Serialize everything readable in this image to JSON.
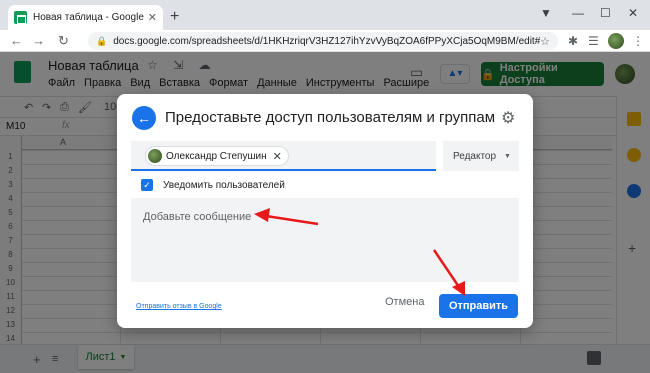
{
  "browser": {
    "tab_title": "Новая таблица - Google Таблицы",
    "tab_close": "✕",
    "new_tab": "+",
    "url": "docs.google.com/spreadsheets/d/1HKHzriqrV3HZ127ihYzvVyBqZOA6fPPyXCja5OqM9BM/edit#gid=0",
    "minimize": "—",
    "maximize": "☐",
    "close": "✕"
  },
  "app": {
    "doc_title": "Новая таблица",
    "menu": [
      "Файл",
      "Правка",
      "Вид",
      "Вставка",
      "Формат",
      "Данные",
      "Инструменты",
      "Расшире"
    ],
    "share_label": "Настройки Доступа",
    "zoom": "100",
    "namebox": "M10",
    "fx": "fx",
    "col_a": "A",
    "row_numbers": [
      "1",
      "2",
      "3",
      "4",
      "5",
      "6",
      "7",
      "8",
      "9",
      "10",
      "11",
      "12",
      "13",
      "14"
    ],
    "sheet_tab": "Лист1"
  },
  "dialog": {
    "title": "Предоставьте доступ пользователям и группам",
    "chip_name": "Олександр Степушин",
    "role": "Редактор",
    "notify_label": "Уведомить пользователей",
    "message_placeholder": "Добавьте сообщение",
    "feedback_link": "Отправить отзыв в Google",
    "cancel_label": "Отмена",
    "send_label": "Отправить"
  },
  "colors": {
    "accent_blue": "#1a73e8",
    "share_green": "#188038",
    "annotation_red": "#e8191a"
  }
}
